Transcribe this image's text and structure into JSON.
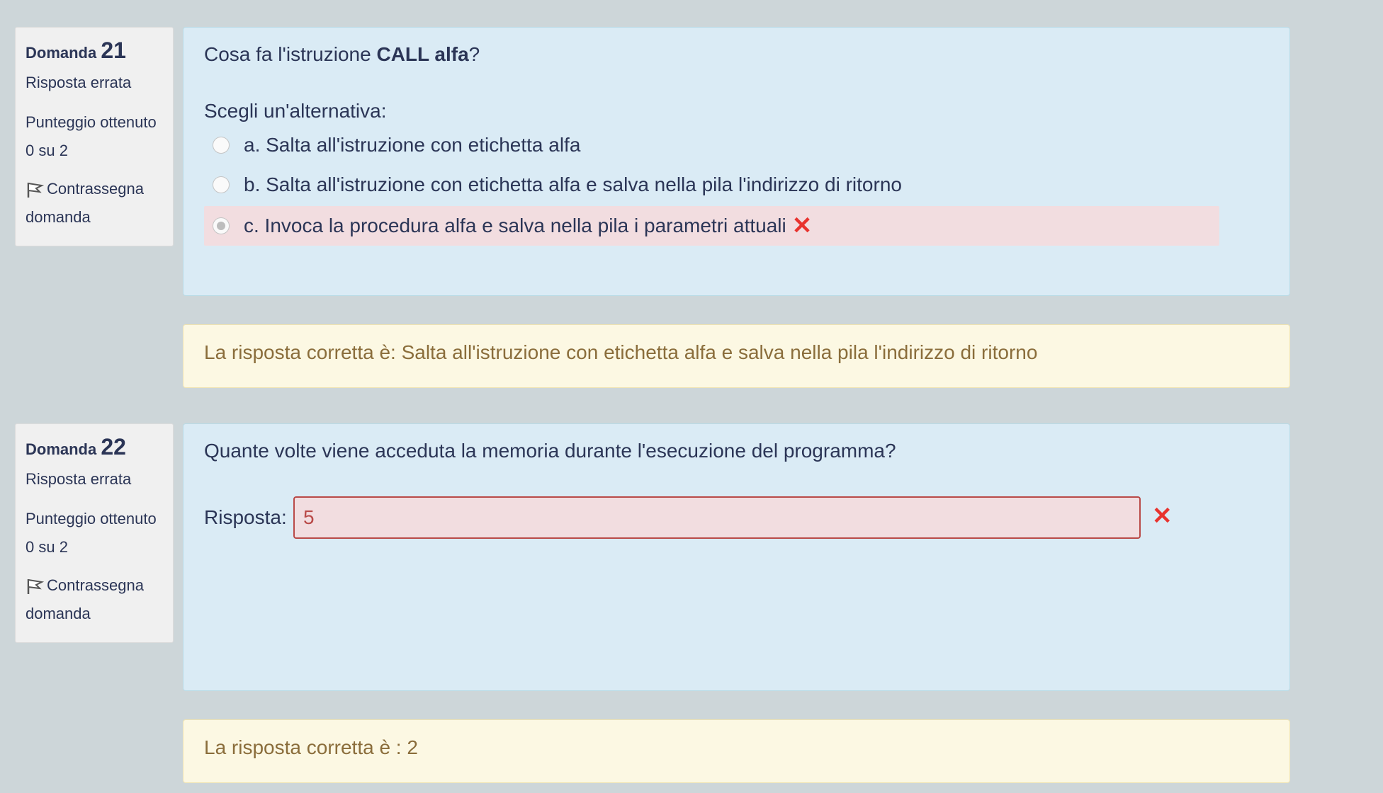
{
  "questions": [
    {
      "label": "Domanda",
      "number": "21",
      "status": "Risposta errata",
      "score_line1": "Punteggio ottenuto",
      "score_line2": "0 su 2",
      "flag_line1": "Contrassegna",
      "flag_line2": "domanda",
      "text_before": "Cosa fa l'istruzione ",
      "text_bold": "CALL alfa",
      "text_after": "?",
      "prompt": "Scegli un'alternativa:",
      "options": [
        {
          "label": "a. Salta all'istruzione con etichetta alfa",
          "selected": false
        },
        {
          "label": "b. Salta all'istruzione con etichetta alfa e salva nella pila l'indirizzo di ritorno",
          "selected": false
        },
        {
          "label": "c. Invoca la procedura alfa e salva nella pila i parametri attuali",
          "selected": true,
          "incorrect": true
        }
      ],
      "feedback": "La risposta corretta è: Salta all'istruzione con etichetta alfa e salva nella pila l'indirizzo di ritorno"
    },
    {
      "label": "Domanda",
      "number": "22",
      "status": "Risposta errata",
      "score_line1": "Punteggio ottenuto",
      "score_line2": "0 su 2",
      "flag_line1": "Contrassegna",
      "flag_line2": "domanda",
      "text": "Quante volte viene acceduta la memoria durante l'esecuzione del programma?",
      "answer_label": "Risposta:",
      "answer_value": "5",
      "feedback": "La risposta corretta è : 2"
    }
  ],
  "icons": {
    "incorrect": "cross-mark-icon",
    "flag": "flag-icon",
    "incorrect_color": "#e8332e"
  },
  "symbols": {
    "cross": "✕"
  }
}
